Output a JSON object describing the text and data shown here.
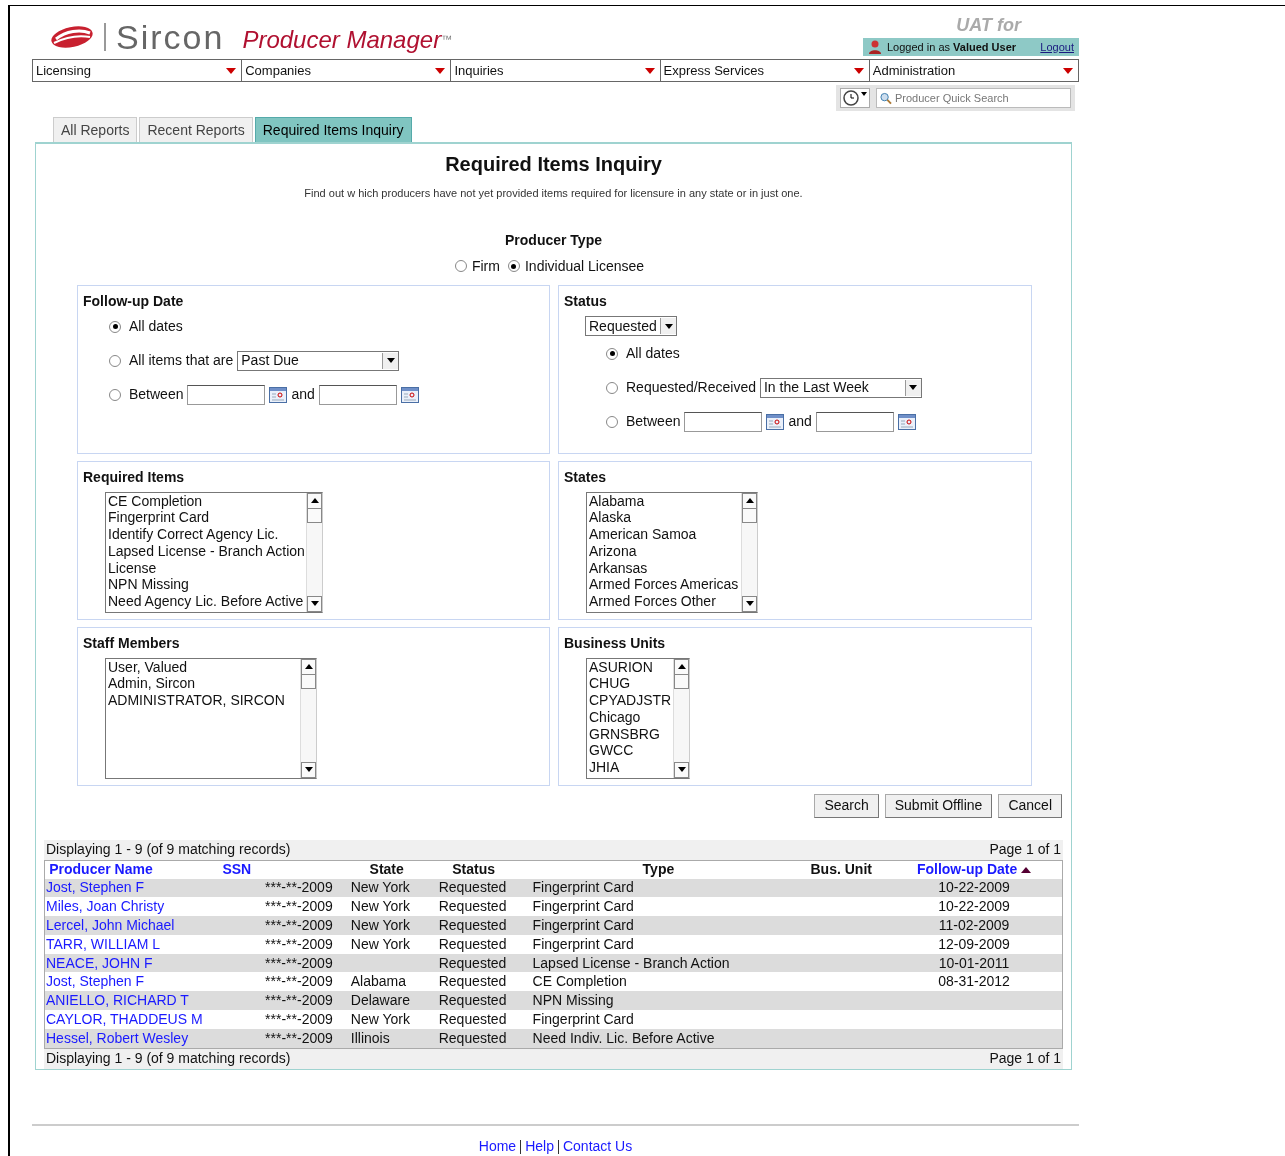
{
  "header": {
    "brand": "Sircon",
    "product": "Producer Manager",
    "trademark": "™",
    "environment": "UAT for",
    "user_bar": {
      "prefix": "Logged in as",
      "user": "Valued User",
      "logout": "Logout"
    }
  },
  "menu": [
    {
      "label": "Licensing"
    },
    {
      "label": "Companies"
    },
    {
      "label": "Inquiries"
    },
    {
      "label": "Express Services"
    },
    {
      "label": "Administration"
    }
  ],
  "quick_search": {
    "placeholder": "Producer Quick Search"
  },
  "tabs": [
    {
      "label": "All Reports",
      "selected": false
    },
    {
      "label": "Recent Reports",
      "selected": false
    },
    {
      "label": "Required Items Inquiry",
      "selected": true
    }
  ],
  "form": {
    "title": "Required Items Inquiry",
    "description": "Find out w hich producers have not yet provided items required for licensure in any state or in just one.",
    "producer_type": {
      "label": "Producer Type",
      "options": [
        {
          "label": "Firm",
          "selected": false
        },
        {
          "label": "Individual Licensee",
          "selected": true
        }
      ]
    },
    "follow_up": {
      "title": "Follow-up Date",
      "options": [
        {
          "kind": "plain",
          "label": "All dates",
          "selected": true
        },
        {
          "kind": "select",
          "label": "All items that are",
          "value": "Past Due",
          "selected": false
        },
        {
          "kind": "range",
          "label": "Between",
          "joiner": "and",
          "selected": false
        }
      ]
    },
    "status": {
      "title": "Status",
      "value": "Requested",
      "options": [
        {
          "kind": "plain",
          "label": "All dates",
          "selected": true
        },
        {
          "kind": "select",
          "label": "Requested/Received",
          "value": "In the Last Week",
          "selected": false
        },
        {
          "kind": "range",
          "label": "Between",
          "joiner": "and",
          "selected": false
        }
      ]
    },
    "lists": [
      {
        "title": "Required Items",
        "items": [
          "CE Completion",
          "Fingerprint Card",
          "Identify Correct Agency Lic.",
          "Lapsed License - Branch Action",
          "License",
          "NPN Missing",
          "Need Agency Lic. Before Active"
        ]
      },
      {
        "title": "States",
        "items": [
          "Alabama",
          "Alaska",
          "American Samoa",
          "Arizona",
          "Arkansas",
          "Armed Forces Americas",
          "Armed Forces Other"
        ]
      },
      {
        "title": "Staff Members",
        "items": [
          "User, Valued",
          "Admin, Sircon",
          "ADMINISTRATOR, SIRCON"
        ]
      },
      {
        "title": "Business Units",
        "items": [
          "ASURION",
          "CHUG",
          "CPYADJSTR",
          "Chicago",
          "GRNSBRG",
          "GWCC",
          "JHIA"
        ]
      }
    ],
    "buttons": [
      "Search",
      "Submit Offline",
      "Cancel"
    ]
  },
  "results": {
    "summary": "Displaying 1 - 9 (of 9 matching records)",
    "page": "Page 1 of 1",
    "columns": [
      {
        "label": "Producer Name",
        "sortable": true,
        "sorted": false
      },
      {
        "label": "SSN",
        "sortable": true,
        "sorted": false
      },
      {
        "label": "State",
        "sortable": false,
        "sorted": false
      },
      {
        "label": "Status",
        "sortable": false,
        "sorted": false
      },
      {
        "label": "Type",
        "sortable": false,
        "sorted": false
      },
      {
        "label": "Bus. Unit",
        "sortable": false,
        "sorted": false
      },
      {
        "label": "Follow-up Date",
        "sortable": true,
        "sorted": true
      }
    ],
    "rows": [
      {
        "name": "Jost, Stephen F",
        "ssn": "***-**-2009",
        "state": "New York",
        "status": "Requested",
        "type": "Fingerprint Card",
        "follow_up": "10-22-2009"
      },
      {
        "name": "Miles, Joan Christy",
        "ssn": "***-**-2009",
        "state": "New York",
        "status": "Requested",
        "type": "Fingerprint Card",
        "follow_up": "10-22-2009"
      },
      {
        "name": "Lercel, John Michael",
        "ssn": "***-**-2009",
        "state": "New York",
        "status": "Requested",
        "type": "Fingerprint Card",
        "follow_up": "11-02-2009"
      },
      {
        "name": "TARR, WILLIAM L",
        "ssn": "***-**-2009",
        "state": "New York",
        "status": "Requested",
        "type": "Fingerprint Card",
        "follow_up": "12-09-2009"
      },
      {
        "name": "NEACE, JOHN F",
        "ssn": "***-**-2009",
        "status": "Requested",
        "type": "Lapsed License - Branch Action",
        "follow_up": "10-01-2011"
      },
      {
        "name": "Jost, Stephen F",
        "ssn": "***-**-2009",
        "state": "Alabama",
        "status": "Requested",
        "type": "CE Completion",
        "follow_up": "08-31-2012"
      },
      {
        "name": "ANIELLO, RICHARD T",
        "ssn": "***-**-2009",
        "state": "Delaware",
        "status": "Requested",
        "type": "NPN Missing"
      },
      {
        "name": "CAYLOR, THADDEUS M",
        "ssn": "***-**-2009",
        "state": "New York",
        "status": "Requested",
        "type": "Fingerprint Card"
      },
      {
        "name": "Hessel, Robert Wesley",
        "ssn": "***-**-2009",
        "state": "Illinois",
        "status": "Requested",
        "type": "Need Indiv. Lic. Before Active"
      }
    ],
    "footer_summary": "Displaying 1 - 9 (of 9 matching records)",
    "footer_page": "Page 1 of 1"
  },
  "footer_links": [
    "Home",
    "Help",
    "Contact Us"
  ]
}
